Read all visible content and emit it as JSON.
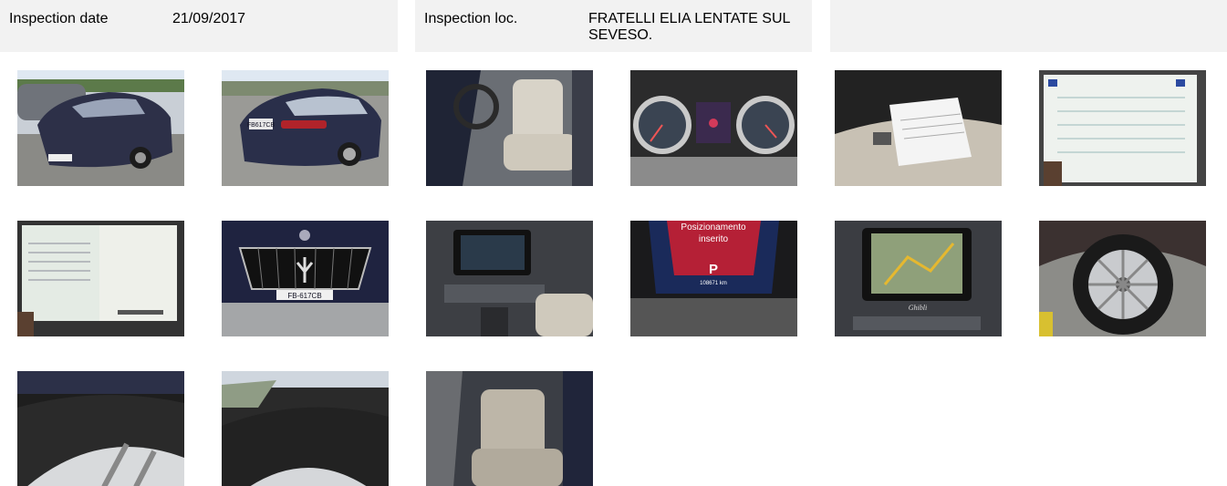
{
  "header": {
    "inspection_date_label": "Inspection date",
    "inspection_date_value": "21/09/2017",
    "inspection_loc_label": "Inspection loc.",
    "inspection_loc_value": "FRATELLI ELIA LENTATE SUL SEVESO."
  },
  "photos": {
    "plate_rear": "FB617CB",
    "plate_front": "FB-617CB",
    "dash_line1": "Posizionamento",
    "dash_line2": "inserito",
    "gear": "P",
    "odometer": "108671 km",
    "nav_brand": "Ghibli"
  },
  "colors": {
    "header_bg": "#f2f2f2",
    "car_body": "#2a2f4a"
  }
}
